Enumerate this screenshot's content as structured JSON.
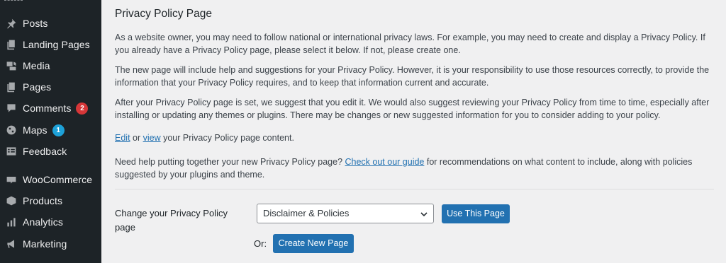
{
  "sidebar": {
    "items": [
      {
        "label": "Posts",
        "icon": "pushpin-icon"
      },
      {
        "label": "Landing Pages",
        "icon": "pages-icon"
      },
      {
        "label": "Media",
        "icon": "media-icon"
      },
      {
        "label": "Pages",
        "icon": "page-icon"
      },
      {
        "label": "Comments",
        "icon": "comment-icon",
        "badge": "2",
        "badge_color": "#d63638"
      },
      {
        "label": "Maps",
        "icon": "globe-icon",
        "badge": "1",
        "badge_color": "#1da1d8"
      },
      {
        "label": "Feedback",
        "icon": "feedback-icon"
      },
      {
        "label": "WooCommerce",
        "icon": "woocommerce-icon"
      },
      {
        "label": "Products",
        "icon": "box-icon"
      },
      {
        "label": "Analytics",
        "icon": "bar-chart-icon"
      },
      {
        "label": "Marketing",
        "icon": "megaphone-icon"
      }
    ]
  },
  "main": {
    "title": "Privacy Policy Page",
    "para1": "As a website owner, you may need to follow national or international privacy laws. For example, you may need to create and display a Privacy Policy. If you already have a Privacy Policy page, please select it below. If not, please create one.",
    "para2": "The new page will include help and suggestions for your Privacy Policy. However, it is your responsibility to use those resources correctly, to provide the information that your Privacy Policy requires, and to keep that information current and accurate.",
    "para3": "After your Privacy Policy page is set, we suggest that you edit it. We would also suggest reviewing your Privacy Policy from time to time, especially after installing or updating any themes or plugins. There may be changes or new suggested information for you to consider adding to your policy.",
    "edit_line": {
      "edit": "Edit",
      "or": " or ",
      "view": "view",
      "rest": " your Privacy Policy page content."
    },
    "help_line": {
      "pre": "Need help putting together your new Privacy Policy page? ",
      "link": "Check out our guide",
      "post": " for recommendations on what content to include, along with policies suggested by your plugins and theme."
    },
    "change_label": "Change your Privacy Policy page",
    "select_value": "Disclaimer & Policies",
    "use_button": "Use This Page",
    "or_label": "Or:",
    "create_button": "Create New Page"
  },
  "colors": {
    "accent": "#2271b1",
    "sidebar_bg": "#1d2327",
    "content_bg": "#f0f0f1"
  }
}
